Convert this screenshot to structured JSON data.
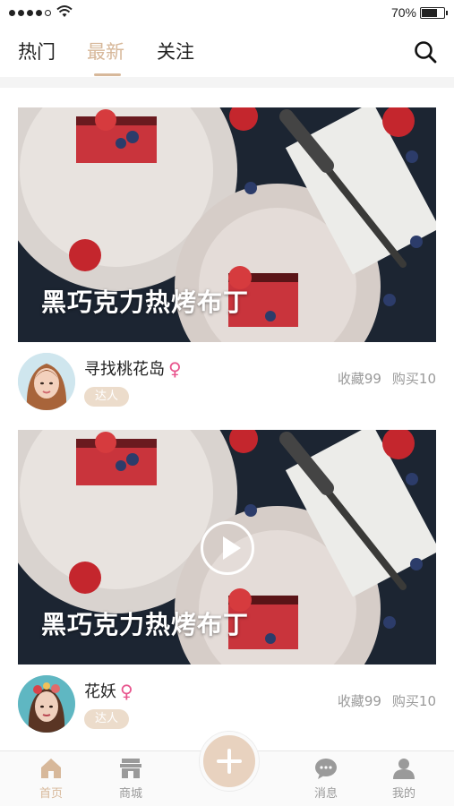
{
  "status_bar": {
    "battery_text": "70%",
    "battery_level": 0.7
  },
  "top_nav": {
    "tabs": [
      {
        "label": "热门"
      },
      {
        "label": "最新",
        "active": true
      },
      {
        "label": "关注"
      }
    ],
    "search_icon": "search-icon"
  },
  "feed": [
    {
      "title": "黑巧克力热烤布丁",
      "is_video": false,
      "author": {
        "name": "寻找桃花岛",
        "gender": "♀",
        "badge": "达人"
      },
      "stats": {
        "favorites": "收藏99",
        "purchases": "购买10"
      }
    },
    {
      "title": "黑巧克力热烤布丁",
      "is_video": true,
      "author": {
        "name": "花妖",
        "gender": "♀",
        "badge": "达人"
      },
      "stats": {
        "favorites": "收藏99",
        "purchases": "购买10"
      }
    }
  ],
  "tab_bar": {
    "items": [
      {
        "label": "首页",
        "icon": "home-icon",
        "active": true
      },
      {
        "label": "商城",
        "icon": "shop-icon"
      },
      {
        "label": "",
        "icon": "plus-icon"
      },
      {
        "label": "消息",
        "icon": "message-icon"
      },
      {
        "label": "我的",
        "icon": "user-icon"
      }
    ]
  },
  "colors": {
    "accent": "#d7b89a",
    "gender": "#e8548d",
    "badge_bg": "#ecdccb"
  }
}
